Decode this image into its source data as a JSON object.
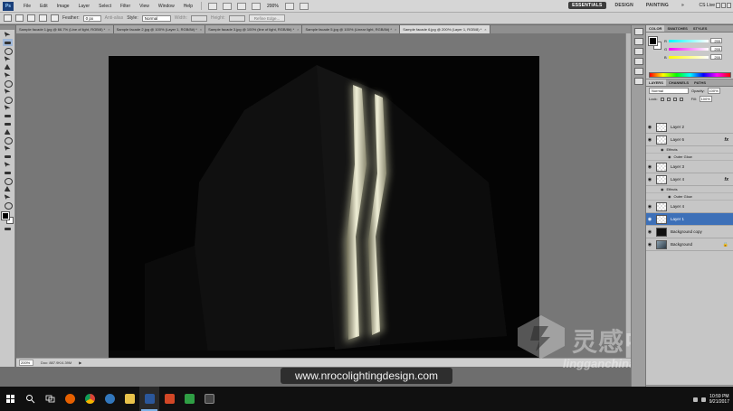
{
  "menubar": {
    "logo": "Ps",
    "items": [
      "File",
      "Edit",
      "Image",
      "Layer",
      "Select",
      "Filter",
      "View",
      "Window",
      "Help"
    ],
    "zoom": "200%",
    "workspaces": [
      "ESSENTIALS",
      "DESIGN",
      "PAINTING"
    ],
    "more": "»",
    "cs_live": "CS Live"
  },
  "options": {
    "feather_label": "Feather:",
    "feather_value": "0 px",
    "antialias_label": "Anti-alias",
    "style_label": "Style:",
    "style_value": "Normal",
    "width_label": "Width:",
    "height_label": "Height:",
    "refine_button": "Refine Edge..."
  },
  "document_tabs": [
    {
      "label": "Sample facade 1.jpg @ 66.7% (Line of light, RGB/8) *",
      "active": false
    },
    {
      "label": "Sample facade 2.jpg @ 100% (Layer 1, RGB/8#) *",
      "active": false
    },
    {
      "label": "Sample facade 3.jpg @ 100% (line of light, RGB/8#) *",
      "active": false
    },
    {
      "label": "Sample facade 5.jpg @ 100% (Linear light, RGB/8#) *",
      "active": false
    },
    {
      "label": "Sample facade 6.jpg @ 200% (Layer 1, RGB/8) *",
      "active": true
    }
  ],
  "status": {
    "zoom": "200%",
    "doc": "Doc: 887.9K/4.39M",
    "arrow": "▶"
  },
  "caption": "www.nrocolightingdesign.com",
  "watermark": {
    "title": "灵感中国",
    "url": "lingganchina.com"
  },
  "color_panel": {
    "tabs": [
      "COLOR",
      "SWATCHES",
      "STYLES"
    ],
    "channels": [
      {
        "label": "R",
        "value": "255",
        "color": "#e03030"
      },
      {
        "label": "G",
        "value": "255",
        "color": "#30b030"
      },
      {
        "label": "B",
        "value": "255",
        "color": "#3050e0"
      }
    ]
  },
  "layers_panel": {
    "tabs": [
      "LAYERS",
      "CHANNELS",
      "PATHS"
    ],
    "blend_mode": "Normal",
    "opacity_label": "Opacity:",
    "opacity": "100%",
    "lock_label": "Lock:",
    "fill_label": "Fill:",
    "fill": "100%",
    "layers": [
      {
        "name": "Layer 2",
        "thumb": "light",
        "fx": false,
        "selected": false
      },
      {
        "name": "Layer 6",
        "thumb": "checker",
        "fx": true,
        "selected": false,
        "effects": [
          "Effects",
          "Outer Glow"
        ]
      },
      {
        "name": "Layer 3",
        "thumb": "light",
        "fx": false,
        "selected": false
      },
      {
        "name": "Layer 4",
        "thumb": "checker",
        "fx": true,
        "selected": false,
        "effects": [
          "Effects",
          "Outer Glow"
        ]
      },
      {
        "name": "Layer 4",
        "thumb": "checker",
        "fx": false,
        "selected": false
      },
      {
        "name": "Layer 1",
        "thumb": "checker",
        "fx": false,
        "selected": true
      },
      {
        "name": "Background copy",
        "thumb": "dark",
        "fx": false,
        "selected": false
      },
      {
        "name": "Background",
        "thumb": "photo",
        "fx": false,
        "selected": false,
        "locked": true
      }
    ],
    "fx_glyph": "fx",
    "lock_glyph": "🔒"
  },
  "taskbar": {
    "items": [
      {
        "name": "search",
        "color": "#ffffff",
        "active": false
      },
      {
        "name": "task-view",
        "color": "#ffffff",
        "active": false
      },
      {
        "name": "firefox",
        "color": "#e66000",
        "active": false
      },
      {
        "name": "chrome",
        "color": "#4caf50",
        "active": false
      },
      {
        "name": "edge",
        "color": "#3277bc",
        "active": false
      },
      {
        "name": "file-explorer",
        "color": "#e8c24a",
        "active": false
      },
      {
        "name": "word",
        "color": "#2b579a",
        "active": true
      },
      {
        "name": "powerpoint",
        "color": "#d24726",
        "active": false
      },
      {
        "name": "green-app",
        "color": "#2f9e44",
        "active": false
      },
      {
        "name": "dark-app",
        "color": "#888888",
        "active": false
      }
    ],
    "time": "10:59 PM",
    "date": "9/21/2017"
  },
  "colors": {
    "selected_layer": "#3d70b8",
    "glow": "#d8d8b0"
  }
}
